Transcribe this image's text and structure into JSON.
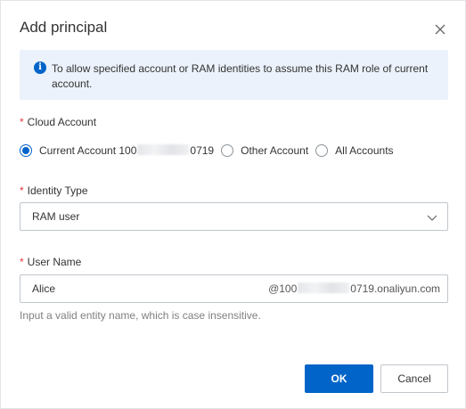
{
  "dialog": {
    "title": "Add principal",
    "close_label": "×",
    "alert": {
      "icon": "info-icon",
      "icon_glyph": "i",
      "text": "To allow specified account or RAM identities to assume this RAM role of current account."
    },
    "cloud_account": {
      "required_mark": "*",
      "label": "Cloud Account",
      "options": [
        {
          "prefix": "Current Account 100",
          "suffix": "0719",
          "checked": true
        },
        {
          "label": "Other Account",
          "checked": false
        },
        {
          "label": "All Accounts",
          "checked": false
        }
      ]
    },
    "identity_type": {
      "required_mark": "*",
      "label": "Identity Type",
      "value": "RAM user"
    },
    "user_name": {
      "required_mark": "*",
      "label": "User Name",
      "value": "Alice",
      "suffix_prefix": "@100",
      "suffix_end": "0719.onaliyun.com",
      "help": "Input a valid entity name, which is case insensitive."
    },
    "buttons": {
      "ok": "OK",
      "cancel": "Cancel"
    }
  },
  "colors": {
    "primary": "#0064c8",
    "alert_bg": "#ebf2fb",
    "required": "#e4393c"
  }
}
